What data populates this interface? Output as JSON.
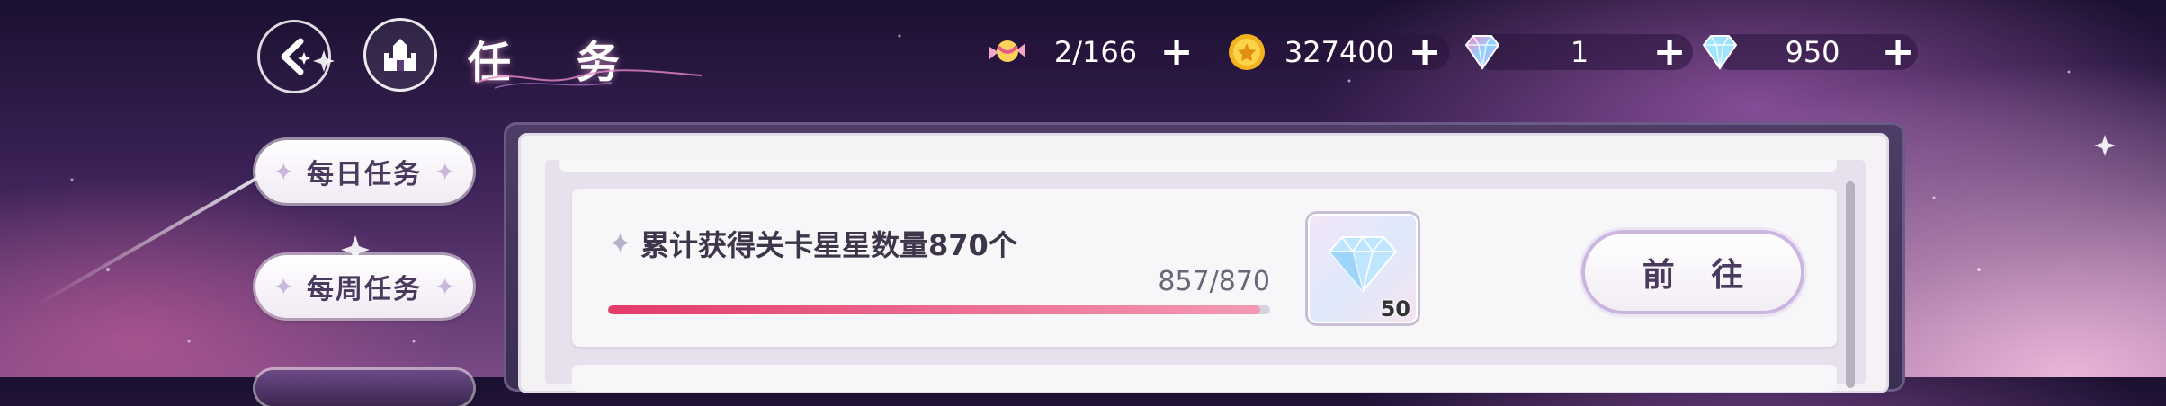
{
  "header": {
    "title": "任 务",
    "currencies": [
      {
        "icon": "candy-icon",
        "value": "2/166"
      },
      {
        "icon": "gold-coin-icon",
        "value": "327400"
      },
      {
        "icon": "rainbow-gem-icon",
        "value": "1"
      },
      {
        "icon": "blue-diamond-icon",
        "value": "950"
      }
    ],
    "plus_label": "+"
  },
  "sidebar": {
    "tabs": [
      {
        "label": "每日任务"
      },
      {
        "label": "每周任务"
      }
    ]
  },
  "task": {
    "title": "累计获得关卡星星数量870个",
    "progress_text": "857/870",
    "progress_current": 857,
    "progress_total": 870,
    "reward": {
      "icon": "diamond-icon",
      "count": "50"
    },
    "button_label": "前 往"
  },
  "colors": {
    "progress_fill": "#e33a6a",
    "panel": "#f4f2f5",
    "button_border": "#cbb6df"
  }
}
